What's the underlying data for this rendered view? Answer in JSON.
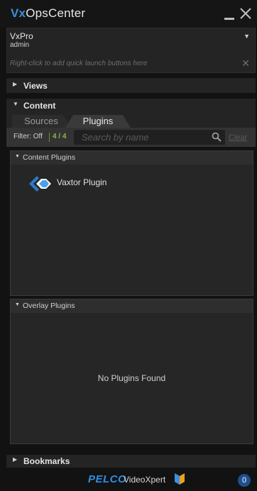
{
  "window": {
    "title_prefix": "Vx",
    "title_suffix": "OpsCenter"
  },
  "user": {
    "name": "VxPro",
    "role": "admin",
    "quick_launch_hint": "Right-click to add quick launch buttons here"
  },
  "sections": {
    "views": "Views",
    "content": "Content",
    "bookmarks": "Bookmarks"
  },
  "tabs": [
    {
      "label": "Sources",
      "selected": false
    },
    {
      "label": "Plugins",
      "selected": true
    }
  ],
  "filter": {
    "label": "Filter: Off",
    "count": "4 / 4",
    "search_placeholder": "Search by name",
    "clear_label": "Clear"
  },
  "content_plugins": {
    "header": "Content Plugins",
    "items": [
      {
        "name": "Vaxtor Plugin",
        "icon": "vaxtor-logo-icon"
      }
    ]
  },
  "overlay_plugins": {
    "header": "Overlay Plugins",
    "empty_text": "No Plugins Found"
  },
  "footer": {
    "brand": "PELCO",
    "product": "VideoXpert",
    "notification_count": "0"
  },
  "colors": {
    "accent_blue": "#3d8fe0",
    "filter_green": "#8fb843",
    "background": "#121212",
    "panel": "#242424"
  }
}
